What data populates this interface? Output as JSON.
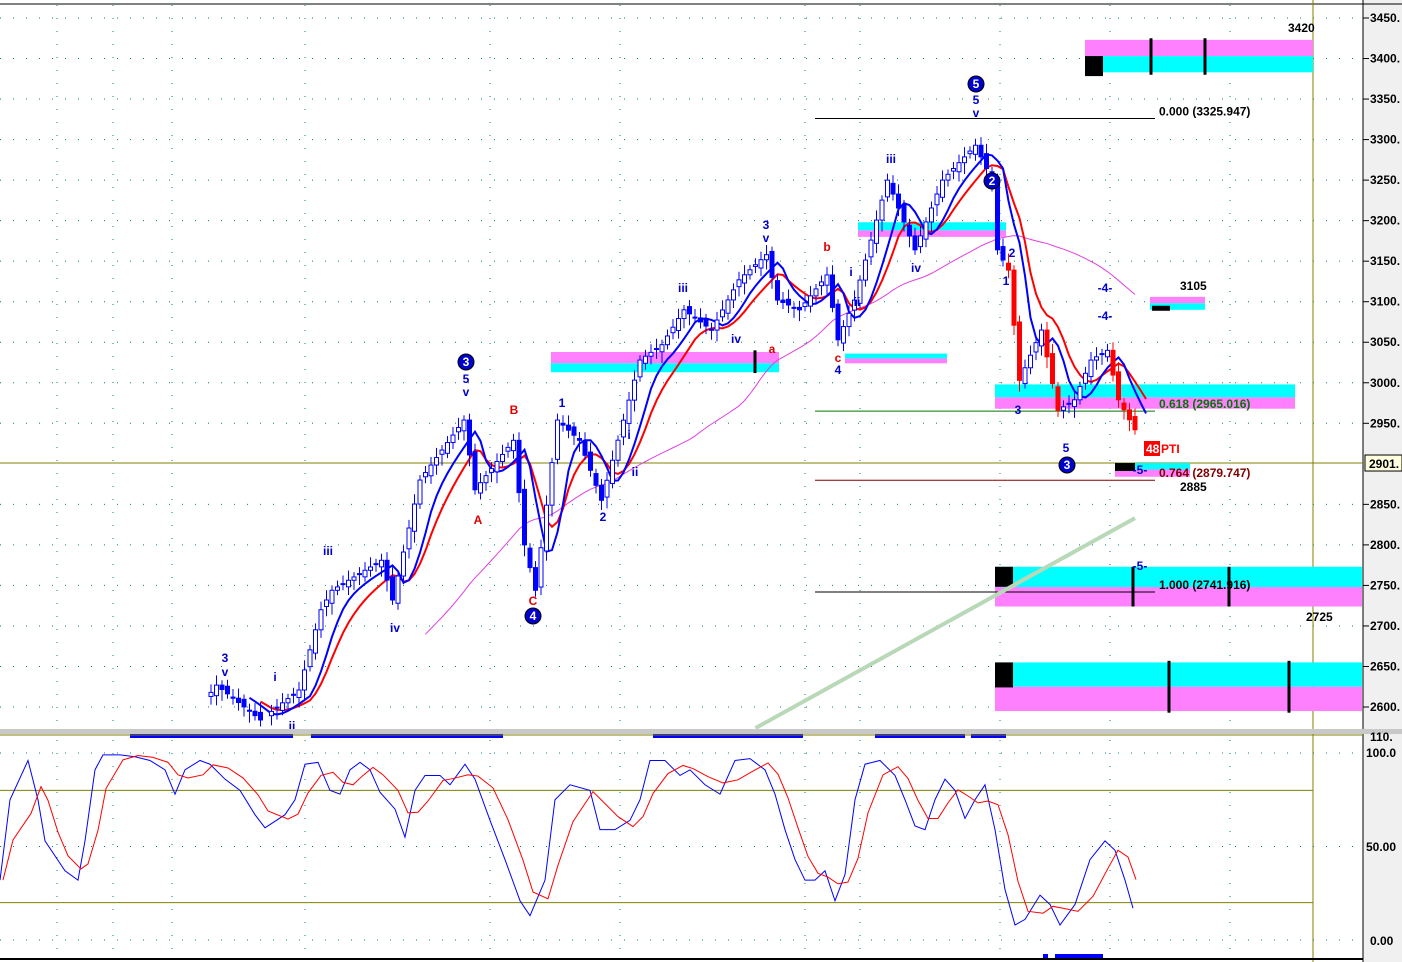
{
  "chart_data": {
    "type": "candlestick",
    "price_axis": {
      "ticks": [
        "3450.",
        "3400.",
        "3350.",
        "3300.",
        "3250.",
        "3200.",
        "3150.",
        "3100.",
        "3050.",
        "3000.",
        "2950.",
        "2850.",
        "2800.",
        "2750.",
        "2700.",
        "2650.",
        "2600."
      ],
      "tick_values": [
        3450,
        3400,
        3350,
        3300,
        3250,
        3200,
        3150,
        3100,
        3050,
        3000,
        2950,
        2850,
        2800,
        2750,
        2700,
        2650,
        2600
      ],
      "ylim": [
        2590,
        3465
      ],
      "current_price_label": "2901.",
      "current_price": 2901
    },
    "swing_points": [
      [
        1,
        2609
      ],
      [
        3,
        2627
      ],
      [
        11,
        2584
      ],
      [
        18,
        2621
      ],
      [
        22,
        2720
      ],
      [
        24,
        2744
      ],
      [
        33,
        2781
      ],
      [
        35,
        2732
      ],
      [
        40,
        2880
      ],
      [
        48,
        2954
      ],
      [
        50,
        2868
      ],
      [
        57,
        2929
      ],
      [
        59,
        2800
      ],
      [
        61,
        2744
      ],
      [
        65,
        2954
      ],
      [
        69,
        2929
      ],
      [
        73,
        2855
      ],
      [
        80,
        3028
      ],
      [
        84,
        3047
      ],
      [
        88,
        3090
      ],
      [
        93,
        3065
      ],
      [
        98,
        3127
      ],
      [
        103,
        3158
      ],
      [
        105,
        3102
      ],
      [
        109,
        3090
      ],
      [
        114,
        3133
      ],
      [
        116,
        3053
      ],
      [
        119,
        3102
      ],
      [
        122,
        3176
      ],
      [
        125,
        3250
      ],
      [
        130,
        3164
      ],
      [
        135,
        3250
      ],
      [
        141,
        3293
      ],
      [
        144,
        3250
      ],
      [
        145,
        3164
      ],
      [
        147,
        3139
      ],
      [
        149,
        3003
      ],
      [
        153,
        3065
      ],
      [
        156,
        2966
      ],
      [
        159,
        2979
      ],
      [
        162,
        3028
      ],
      [
        165,
        3040
      ],
      [
        167,
        2979
      ],
      [
        170,
        2942
      ]
    ],
    "long_ma_line": {
      "from": [
        101,
        2574
      ],
      "to": [
        170,
        2833
      ]
    },
    "fib_levels": [
      {
        "label": "0.000 (3325.947)",
        "price": 3325.947,
        "color": "#000000"
      },
      {
        "label": "0.618 (2965.016)",
        "price": 2965.016,
        "color": "#007700"
      },
      {
        "label": "0.764 (2879.747)",
        "price": 2879.747,
        "color": "#800000"
      },
      {
        "label": "1.000 (2741.916)",
        "price": 2741.916,
        "color": "#000000"
      }
    ],
    "target_labels": [
      "3420",
      "3105",
      "2885",
      "2725"
    ],
    "wave_labels": [
      "3",
      "v",
      "i",
      "ii",
      "iii",
      "iv",
      "3",
      "5",
      "v",
      "A",
      "B",
      "C",
      "4",
      "1",
      "2",
      "i",
      "ii",
      "iii",
      "iv",
      "a",
      "3",
      "v",
      "b",
      "c",
      "4",
      "i",
      "ii",
      "iii",
      "iv",
      "5",
      "5",
      "v",
      "2",
      "2",
      "1",
      "3",
      "5",
      "3",
      "-4-",
      "-4-",
      "-5-",
      "-5-"
    ],
    "badge": {
      "number": "48",
      "text": "PTI"
    },
    "oscillator": {
      "type": "stochastic",
      "ticks": [
        "110.",
        "100.0",
        "50.00",
        "0.00"
      ],
      "tick_values": [
        100,
        50,
        0
      ],
      "levels": [
        80,
        20
      ],
      "k_points": [
        [
          0,
          32
        ],
        [
          10,
          75
        ],
        [
          28,
          96
        ],
        [
          38,
          75
        ],
        [
          45,
          53
        ],
        [
          55,
          45
        ],
        [
          65,
          37
        ],
        [
          78,
          32
        ],
        [
          85,
          53
        ],
        [
          95,
          91
        ],
        [
          103,
          99
        ],
        [
          120,
          99
        ],
        [
          135,
          98
        ],
        [
          150,
          96
        ],
        [
          165,
          91
        ],
        [
          175,
          78
        ],
        [
          185,
          91
        ],
        [
          200,
          96
        ],
        [
          210,
          94
        ],
        [
          225,
          86
        ],
        [
          240,
          80
        ],
        [
          255,
          67
        ],
        [
          265,
          60
        ],
        [
          285,
          67
        ],
        [
          295,
          75
        ],
        [
          305,
          94
        ],
        [
          318,
          95
        ],
        [
          330,
          80
        ],
        [
          340,
          78
        ],
        [
          350,
          91
        ],
        [
          360,
          95
        ],
        [
          370,
          91
        ],
        [
          380,
          79
        ],
        [
          395,
          70
        ],
        [
          405,
          55
        ],
        [
          415,
          80
        ],
        [
          425,
          88
        ],
        [
          440,
          88
        ],
        [
          450,
          83
        ],
        [
          465,
          94
        ],
        [
          475,
          86
        ],
        [
          490,
          64
        ],
        [
          505,
          43
        ],
        [
          520,
          21
        ],
        [
          530,
          13
        ],
        [
          545,
          32
        ],
        [
          555,
          75
        ],
        [
          570,
          83
        ],
        [
          590,
          80
        ],
        [
          600,
          59
        ],
        [
          615,
          59
        ],
        [
          630,
          64
        ],
        [
          640,
          75
        ],
        [
          650,
          96
        ],
        [
          665,
          96
        ],
        [
          680,
          88
        ],
        [
          690,
          91
        ],
        [
          705,
          83
        ],
        [
          720,
          78
        ],
        [
          735,
          96
        ],
        [
          750,
          97
        ],
        [
          765,
          91
        ],
        [
          775,
          78
        ],
        [
          785,
          59
        ],
        [
          795,
          43
        ],
        [
          805,
          32
        ],
        [
          815,
          32
        ],
        [
          825,
          37
        ],
        [
          835,
          21
        ],
        [
          845,
          35
        ],
        [
          855,
          75
        ],
        [
          865,
          94
        ],
        [
          880,
          96
        ],
        [
          895,
          88
        ],
        [
          905,
          75
        ],
        [
          915,
          61
        ],
        [
          925,
          59
        ],
        [
          935,
          75
        ],
        [
          945,
          86
        ],
        [
          955,
          80
        ],
        [
          965,
          65
        ],
        [
          975,
          75
        ],
        [
          985,
          83
        ],
        [
          995,
          59
        ],
        [
          1005,
          27
        ],
        [
          1015,
          8
        ],
        [
          1025,
          11
        ],
        [
          1040,
          24
        ],
        [
          1050,
          19
        ],
        [
          1060,
          8
        ],
        [
          1075,
          19
        ],
        [
          1090,
          43
        ],
        [
          1105,
          53
        ],
        [
          1115,
          48
        ],
        [
          1125,
          32
        ],
        [
          1133,
          17
        ]
      ]
    },
    "colors": {
      "fast_ma": "#0000ff",
      "slow_ma": "#ff0000",
      "long_ma": "#e040e0",
      "trend_ma": "#b8d8b8",
      "zone_top": "#00ffff",
      "zone_bottom": "#ff80ff",
      "grid": "#008080",
      "frame": "#808000"
    }
  }
}
